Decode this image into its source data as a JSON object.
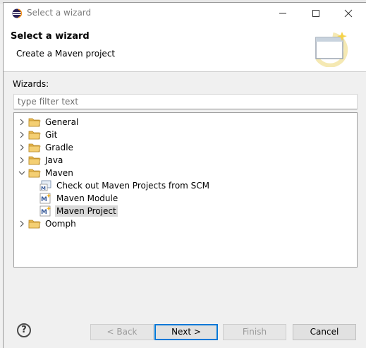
{
  "window": {
    "title": "Select a wizard",
    "buttons": {
      "minimize": "minimize-icon",
      "maximize": "maximize-icon",
      "close": "close-icon"
    }
  },
  "banner": {
    "title": "Select a wizard",
    "description": "Create a Maven project",
    "graphic": "wizard-banner-icon"
  },
  "wizards": {
    "label": "Wizards:",
    "filter_placeholder": "type filter text",
    "filter_value": ""
  },
  "tree": {
    "items": [
      {
        "label": "General",
        "type": "folder",
        "expanded": false,
        "level": 0
      },
      {
        "label": "Git",
        "type": "folder",
        "expanded": false,
        "level": 0
      },
      {
        "label": "Gradle",
        "type": "folder",
        "expanded": false,
        "level": 0
      },
      {
        "label": "Java",
        "type": "folder",
        "expanded": false,
        "level": 0
      },
      {
        "label": "Maven",
        "type": "folder",
        "expanded": true,
        "level": 0
      },
      {
        "label": "Check out Maven Projects from SCM",
        "type": "maven-scm",
        "level": 1
      },
      {
        "label": "Maven Module",
        "type": "maven-module",
        "level": 1
      },
      {
        "label": "Maven Project",
        "type": "maven-project",
        "level": 1,
        "selected": true
      },
      {
        "label": "Oomph",
        "type": "folder",
        "expanded": false,
        "level": 0
      }
    ]
  },
  "footer": {
    "help_icon": "help-icon",
    "back": "< Back",
    "next": "Next >",
    "finish": "Finish",
    "cancel": "Cancel"
  },
  "colors": {
    "accent": "#0078d7",
    "folder": "#e8b64c",
    "selection": "#d9d9d9"
  }
}
